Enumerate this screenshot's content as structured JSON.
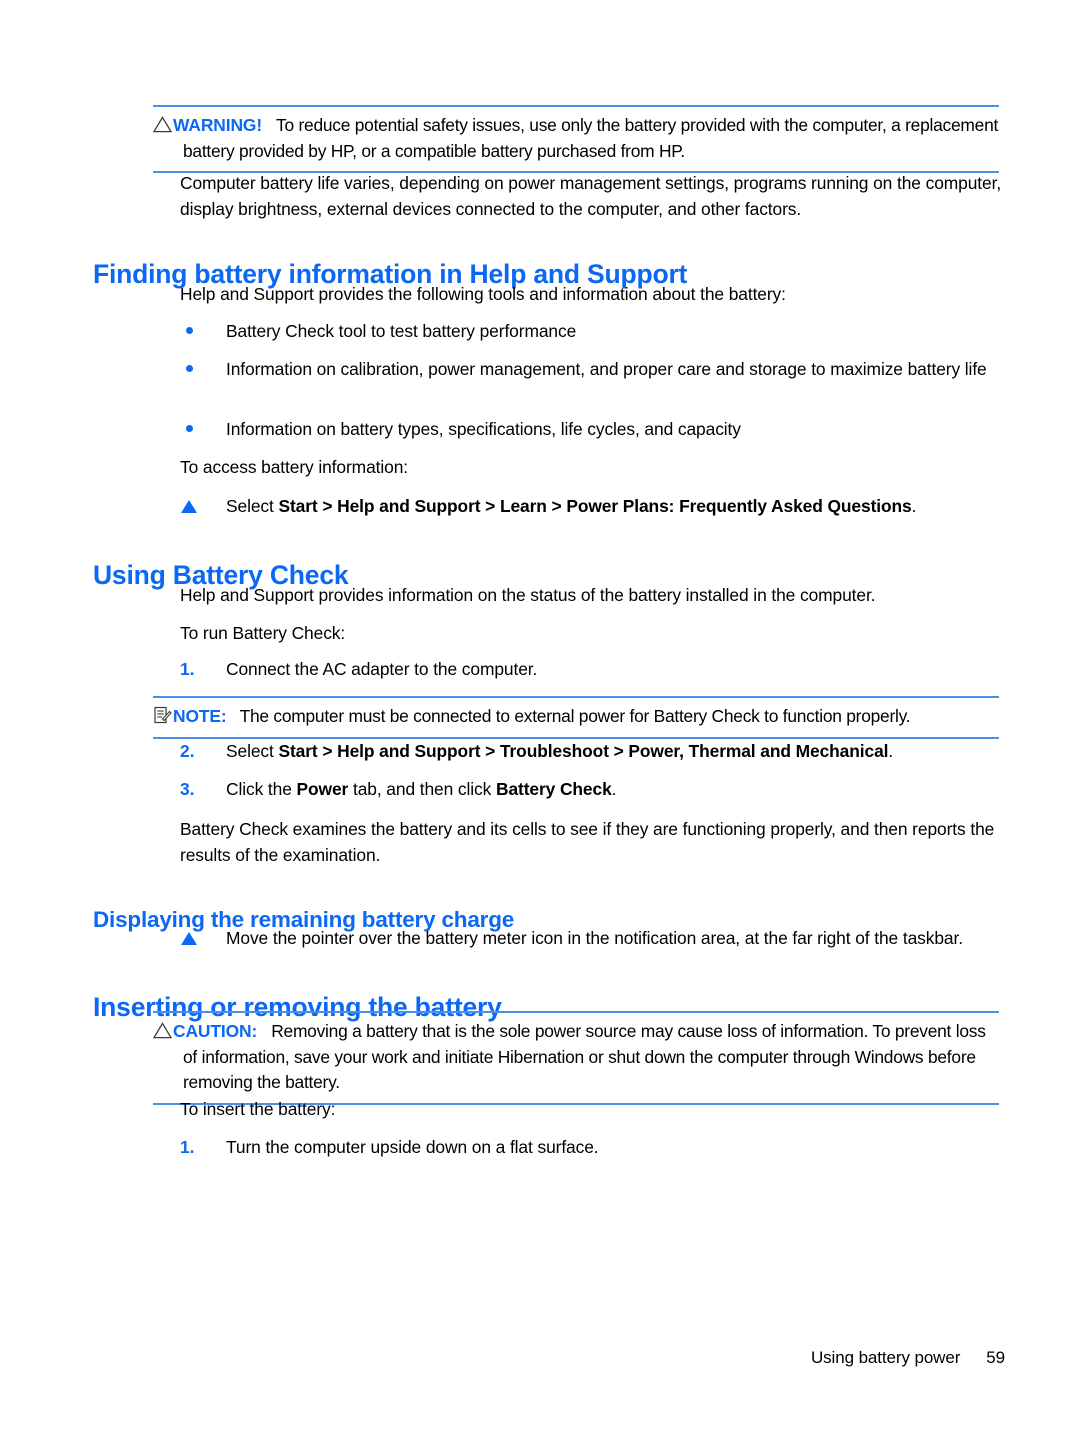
{
  "page": {
    "footer_label": "Using battery power",
    "page_number": "59"
  },
  "colors": {
    "heading_blue": "#0B68F5",
    "rule_blue": "#4A8FE8",
    "body_black": "#000000"
  },
  "notices": {
    "warning": {
      "icon": "warning-triangle-icon",
      "label": "WARNING!",
      "text": "To reduce potential safety issues, use only the battery provided with the computer, a replacement battery provided by HP, or a compatible battery purchased from HP."
    },
    "note": {
      "icon": "note-clipboard-icon",
      "label": "NOTE:",
      "text": "The computer must be connected to external power for Battery Check to function properly."
    },
    "caution": {
      "icon": "caution-triangle-icon",
      "label": "CAUTION:",
      "text_1": "Removing a battery that is the sole power source may cause loss of information. To prevent",
      "text_2": "loss of information, save your work and initiate Hibernation or shut down the computer through Windows",
      "text_3": "before removing the battery."
    }
  },
  "intro_paragraph": {
    "line_1": "Computer battery life varies, depending on power management settings, programs running on the",
    "line_2": "computer, display brightness, external devices connected to the computer, and other factors."
  },
  "sections": {
    "finding_battery_info": {
      "heading": "Finding battery information in Help and Support",
      "intro": "Help and Support provides the following tools and information about the battery:",
      "bullets": [
        "Battery Check tool to test battery performance",
        "Information on calibration, power management, and proper care and storage to maximize battery life",
        "Information on battery types, specifications, life cycles, and capacity"
      ],
      "access_lead": "To access battery information:",
      "step": {
        "prefix": "Select ",
        "bold": "Start > Help and Support > Learn > Power Plans: Frequently Asked Questions",
        "suffix": "."
      }
    },
    "using_battery_check": {
      "heading": "Using Battery Check",
      "intro": "Help and Support provides information on the status of the battery installed in the computer.",
      "run_lead": "To run Battery Check:",
      "steps": [
        {
          "number": "1.",
          "prefix": "Connect the AC adapter to the computer.",
          "bold": "",
          "suffix": ""
        },
        {
          "number": "2.",
          "prefix": "Select ",
          "bold": "Start > Help and Support > Troubleshoot > Power, Thermal and Mechanical",
          "suffix": "."
        },
        {
          "number": "3.",
          "prefix": "Click the ",
          "bold": "Power",
          "mid": " tab, and then click ",
          "bold2": "Battery Check",
          "suffix": "."
        }
      ],
      "summary_1": "Battery Check examines the battery and its cells to see if they are functioning properly, and then reports",
      "summary_2": "the results of the examination."
    },
    "displaying_charge": {
      "heading": "Displaying the remaining battery charge",
      "step": "Move the pointer over the battery meter icon in the notification area, at the far right of the taskbar."
    },
    "inserting_removing": {
      "heading": "Inserting or removing the battery",
      "insert_lead": "To insert the battery:",
      "steps": [
        {
          "number": "1.",
          "text": "Turn the computer upside down on a flat surface."
        }
      ]
    }
  }
}
